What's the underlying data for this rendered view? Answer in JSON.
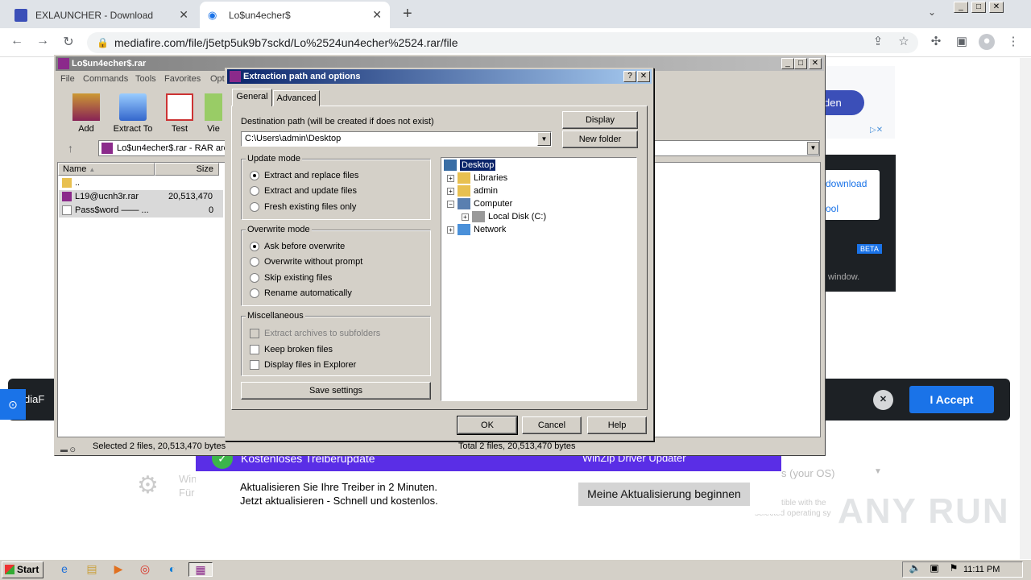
{
  "browser": {
    "tabs": [
      {
        "label": "EXLAUNCHER - Download"
      },
      {
        "label": "Lo$un4echer$"
      }
    ],
    "new_tab": "+",
    "url": "mediafire.com/file/j5etp5uk9b7sckd/Lo%2524un4echer%2524.rar/file"
  },
  "webpage": {
    "cookie_prefix": "MediaF",
    "accept_label": "I Accept",
    "right_btn": "den",
    "download_link": "download",
    "tool_link": "ool",
    "beta_badge": "BETA",
    "window_text": "window.",
    "os_text": "s (your OS)",
    "compat_text": "compatible with the",
    "compat_text2": "selected operating sy",
    "ad_title": "Kostenloses Treiberupdate",
    "ad_brand": "WinZip Driver Updater",
    "ad_line1": "Aktualisieren Sie Ihre Treiber in 2 Minuten.",
    "ad_line2": "Jetzt aktualisieren - Schnell und kostenlos.",
    "ad_button": "Meine Aktualisierung beginnen",
    "ad_side1": "Win",
    "ad_side2": "Für",
    "watermark": "ANY RUN"
  },
  "winrar": {
    "title": "Lo$un4echer$.rar",
    "menu": [
      "File",
      "Commands",
      "Tools",
      "Favorites",
      "Opt"
    ],
    "tools": [
      "Add",
      "Extract To",
      "Test",
      "Vie"
    ],
    "path": "Lo$un4echer$.rar - RAR arc",
    "col_name": "Name",
    "col_size": "Size",
    "files": [
      {
        "name": "..",
        "size": ""
      },
      {
        "name": "L19@ucnh3r.rar",
        "size": "20,513,470"
      },
      {
        "name": "Pass$word —— ...",
        "size": "0"
      }
    ],
    "status_left": "Selected 2 files, 20,513,470 bytes",
    "status_right": "Total 2 files, 20,513,470 bytes"
  },
  "dialog": {
    "title": "Extraction path and options",
    "help": "?",
    "tabs": [
      "General",
      "Advanced"
    ],
    "dest_label": "Destination path (will be created if does not exist)",
    "dest_value": "C:\\Users\\admin\\Desktop",
    "display_btn": "Display",
    "new_folder_btn": "New folder",
    "update_mode": {
      "title": "Update mode",
      "options": [
        "Extract and replace files",
        "Extract and update files",
        "Fresh existing files only"
      ],
      "selected": 0
    },
    "overwrite_mode": {
      "title": "Overwrite mode",
      "options": [
        "Ask before overwrite",
        "Overwrite without prompt",
        "Skip existing files",
        "Rename automatically"
      ],
      "selected": 0
    },
    "misc": {
      "title": "Miscellaneous",
      "options": [
        "Extract archives to subfolders",
        "Keep broken files",
        "Display files in Explorer"
      ]
    },
    "save_settings": "Save settings",
    "tree": [
      "Desktop",
      "Libraries",
      "admin",
      "Computer",
      "Local Disk (C:)",
      "Network"
    ],
    "ok": "OK",
    "cancel": "Cancel",
    "helpbtn": "Help"
  },
  "taskbar": {
    "start": "Start",
    "clock": "11:11 PM"
  }
}
